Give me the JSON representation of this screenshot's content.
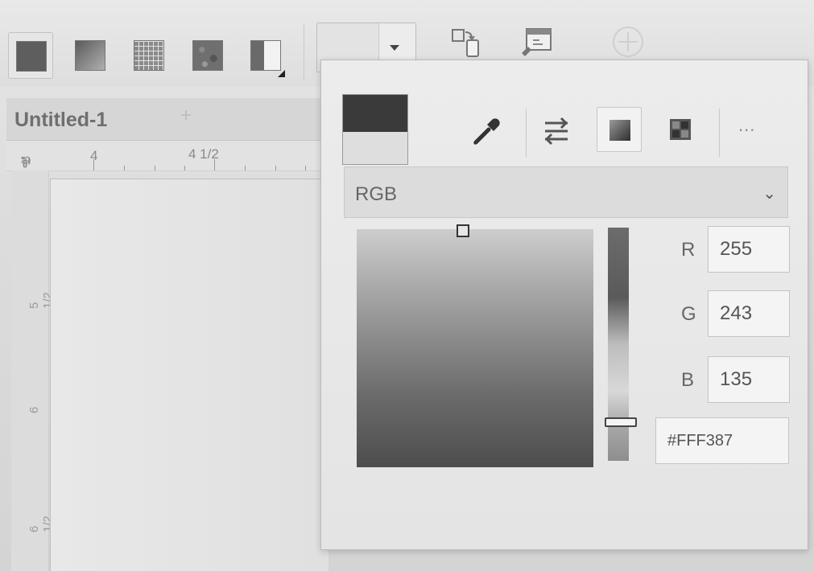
{
  "document": {
    "title": "Untitled-1",
    "close_glyph": "+"
  },
  "ruler": {
    "corner_icon": "ruler-units-icon",
    "corner_glyph": "⅌",
    "labels": [
      "4",
      "4 1/2"
    ],
    "vertical_labels": [
      "5 1/2",
      "6",
      "6 1/2"
    ]
  },
  "toolbar": {
    "fill_types": [
      "flat-fill",
      "linear-gradient-fill",
      "pattern-fill",
      "bitmap-fill",
      "no-fill"
    ],
    "color_dropdown_value": "",
    "icons": [
      "swap-color-icon",
      "window-color-icon",
      "add-color-icon"
    ]
  },
  "color_popup": {
    "color_model": "RGB",
    "more_label": "...",
    "channels": [
      {
        "label": "R",
        "value": "255"
      },
      {
        "label": "G",
        "value": "243"
      },
      {
        "label": "B",
        "value": "135"
      }
    ],
    "hex": "#FFF387",
    "hue_position_fraction": 0.83
  },
  "colors": {
    "current": "#FFF387",
    "previous": "#3a3a3a"
  }
}
